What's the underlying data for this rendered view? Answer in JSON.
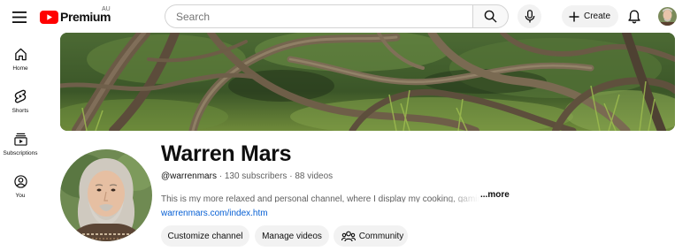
{
  "header": {
    "logo_text": "Premium",
    "logo_region": "AU",
    "search_placeholder": "Search",
    "create_label": "Create"
  },
  "sidebar": {
    "items": [
      {
        "label": "Home",
        "icon": "home-icon"
      },
      {
        "label": "Shorts",
        "icon": "shorts-icon"
      },
      {
        "label": "Subscriptions",
        "icon": "subscriptions-icon"
      },
      {
        "label": "You",
        "icon": "you-icon"
      }
    ]
  },
  "channel": {
    "name": "Warren Mars",
    "handle": "@warrenmars",
    "subscribers": "130 subscribers",
    "videos": "88 videos",
    "separator": " · ",
    "description": "This is my more relaxed and personal channel, where I display my cooking, gaming, personal",
    "more_label": "...more",
    "link": "warrenmars.com/index.htm"
  },
  "actions": {
    "customize_label": "Customize channel",
    "manage_label": "Manage videos",
    "community_label": "Community"
  },
  "colors": {
    "brand_red": "#ff0000",
    "link_blue": "#065fd4",
    "chip_bg": "#f2f2f2",
    "secondary_text": "#606060"
  }
}
